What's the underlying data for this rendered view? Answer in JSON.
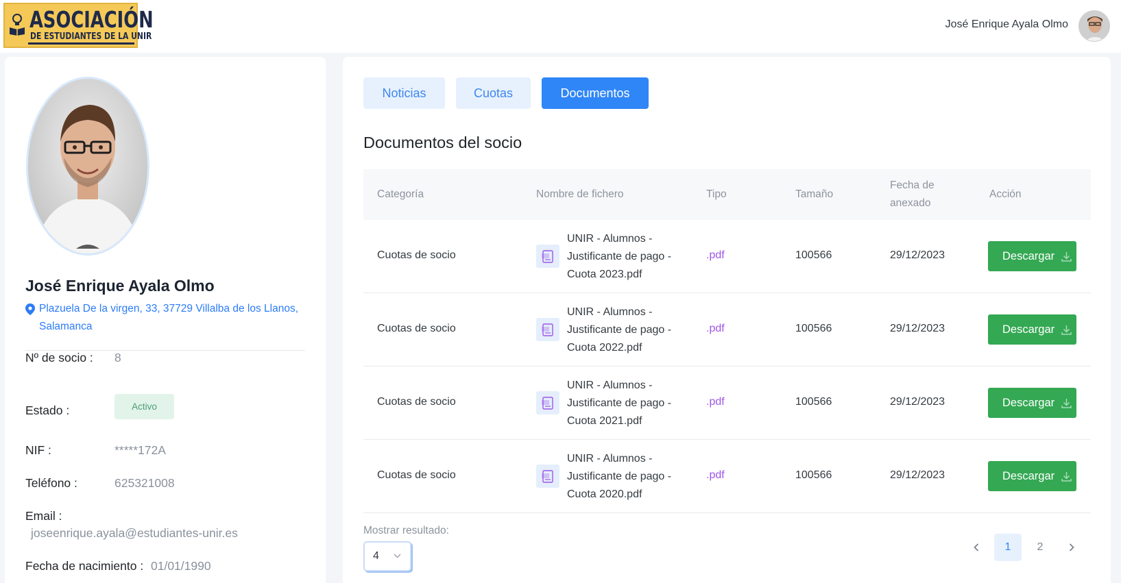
{
  "header": {
    "logo": {
      "title": "ASOCIACIÓN",
      "subtitle": "DE ESTUDIANTES DE LA UNIR"
    },
    "user_name": "José Enrique Ayala Olmo"
  },
  "profile": {
    "name": "José Enrique Ayala Olmo",
    "address": "Plazuela De la virgen, 33, 37729 Villalba de los Llanos, Salamanca",
    "fields": {
      "socio_label": "Nº de socio :",
      "socio_value": "8",
      "estado_label": "Estado :",
      "estado_value": "Activo",
      "nif_label": "NIF :",
      "nif_value": "*****172A",
      "telefono_label": "Teléfono :",
      "telefono_value": "625321008",
      "email_label": "Email :",
      "email_value": "joseenrique.ayala@estudiantes-unir.es",
      "nacimiento_label": "Fecha de nacimiento :",
      "nacimiento_value": "01/01/1990"
    }
  },
  "tabs": [
    {
      "label": "Noticias",
      "active": false
    },
    {
      "label": "Cuotas",
      "active": false
    },
    {
      "label": "Documentos",
      "active": true
    }
  ],
  "documents": {
    "title": "Documentos del socio",
    "columns": [
      "Categoría",
      "Nombre de fichero",
      "Tipo",
      "Tamaño",
      "Fecha de anexado",
      "Acción"
    ],
    "rows": [
      {
        "categoria": "Cuotas de socio",
        "nombre": "UNIR - Alumnos - Justificante de pago - Cuota 2023.pdf",
        "tipo": ".pdf",
        "tamano": "100566",
        "fecha": "29/12/2023",
        "accion": "Descargar"
      },
      {
        "categoria": "Cuotas de socio",
        "nombre": "UNIR - Alumnos - Justificante de pago - Cuota 2022.pdf",
        "tipo": ".pdf",
        "tamano": "100566",
        "fecha": "29/12/2023",
        "accion": "Descargar"
      },
      {
        "categoria": "Cuotas de socio",
        "nombre": "UNIR - Alumnos - Justificante de pago - Cuota 2021.pdf",
        "tipo": ".pdf",
        "tamano": "100566",
        "fecha": "29/12/2023",
        "accion": "Descargar"
      },
      {
        "categoria": "Cuotas de socio",
        "nombre": "UNIR - Alumnos - Justificante de pago - Cuota 2020.pdf",
        "tipo": ".pdf",
        "tamano": "100566",
        "fecha": "29/12/2023",
        "accion": "Descargar"
      }
    ],
    "show_label": "Mostrar resultado:",
    "page_size": "4",
    "pagination": {
      "pages": [
        "1",
        "2"
      ],
      "current": "1"
    }
  },
  "colors": {
    "accent": "#2f86f7",
    "download": "#34a853",
    "pdf": "#9d57e8",
    "logo_bg": "#f5c957"
  }
}
